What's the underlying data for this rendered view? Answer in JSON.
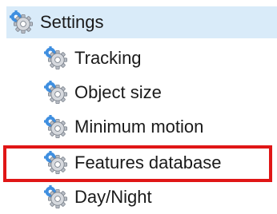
{
  "tree": {
    "root": {
      "label": "Settings",
      "icon": "gear-icon",
      "selected": true
    },
    "children": [
      {
        "label": "Tracking",
        "icon": "gear-icon"
      },
      {
        "label": "Object size",
        "icon": "gear-icon"
      },
      {
        "label": "Minimum motion",
        "icon": "gear-icon"
      },
      {
        "label": "Features database",
        "icon": "gear-icon",
        "highlighted": true
      },
      {
        "label": "Day/Night",
        "icon": "gear-icon"
      }
    ]
  },
  "colors": {
    "selection_bg": "#d9ebf9",
    "highlight_border": "#e01616",
    "gear_fill": "#c8ccd2",
    "gear_accent": "#3f8fe0"
  }
}
